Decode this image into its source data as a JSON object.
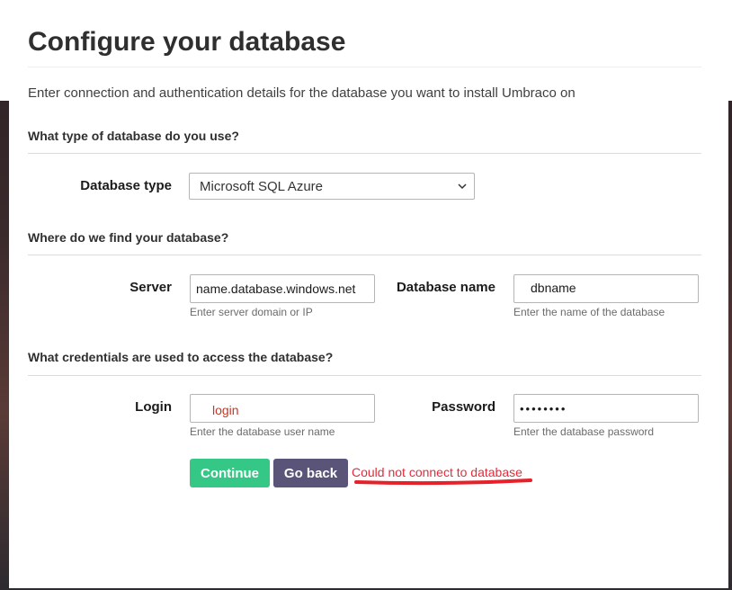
{
  "page": {
    "title": "Configure your database",
    "intro": "Enter connection and authentication details for the database you want to install Umbraco on"
  },
  "sections": {
    "type": "What type of database do you use?",
    "location": "Where do we find your database?",
    "credentials": "What credentials are used to access the database?"
  },
  "fields": {
    "database_type": {
      "label": "Database type",
      "value": "Microsoft SQL Azure"
    },
    "server": {
      "label": "Server",
      "value": "name.database.windows.net",
      "hint": "Enter server domain or IP"
    },
    "database_name": {
      "label": "Database name",
      "value": "dbname",
      "hint": "Enter the name of the database"
    },
    "login": {
      "label": "Login",
      "value": "login",
      "hint": "Enter the database user name"
    },
    "password": {
      "label": "Password",
      "value": "••••••••",
      "hint": "Enter the database password"
    }
  },
  "actions": {
    "continue": "Continue",
    "go_back": "Go back"
  },
  "status": {
    "error": "Could not connect to database"
  },
  "colors": {
    "continue": "#35c786",
    "go_back": "#5a5578",
    "error": "#e22c3c",
    "login_text": "#c0392b"
  },
  "icons": {
    "select_arrow": "chevron-down-icon",
    "error_mark": "red-underline-annotation"
  }
}
